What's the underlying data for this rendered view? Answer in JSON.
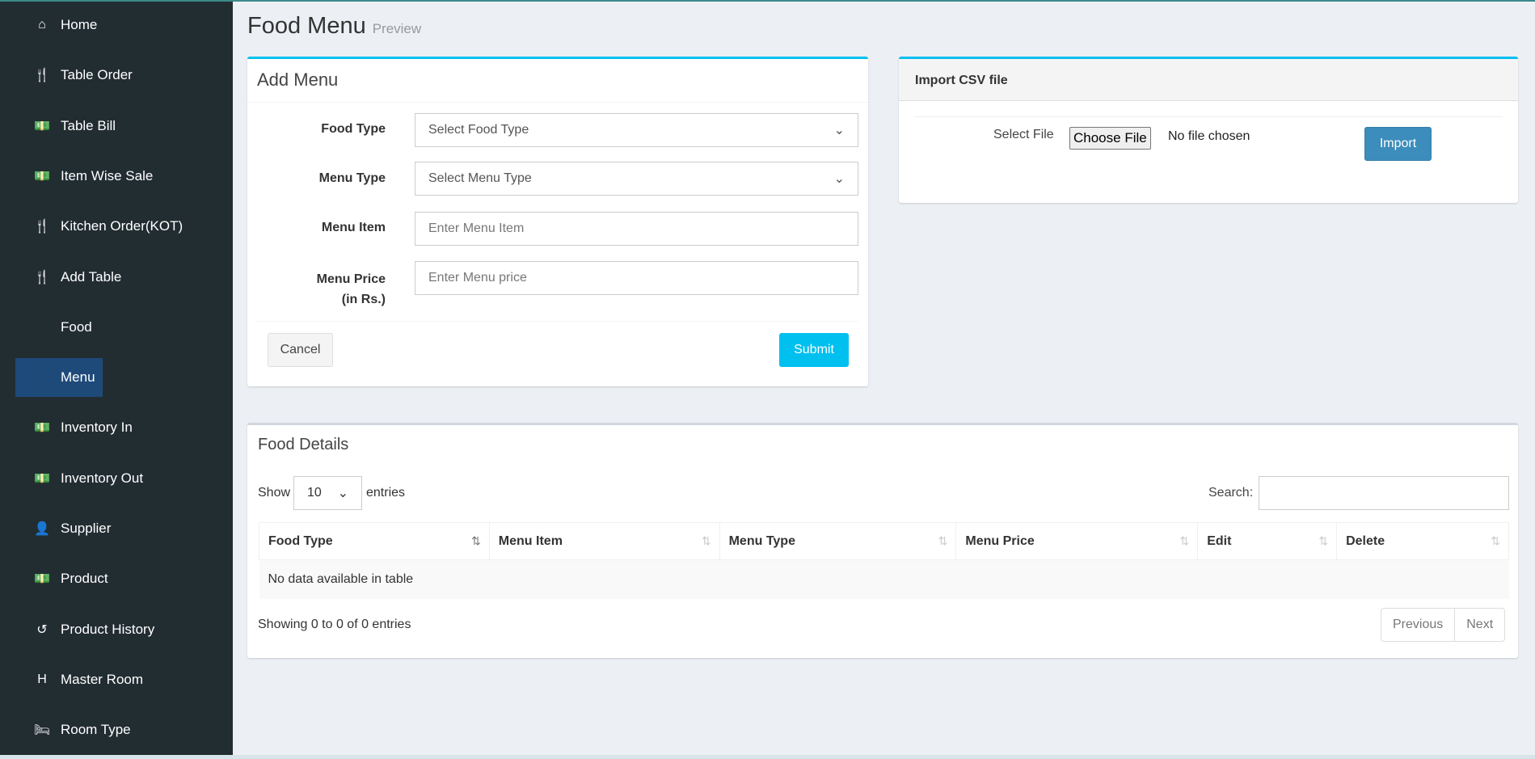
{
  "sidebar": {
    "items": [
      {
        "label": "Home",
        "icon": "home-icon",
        "glyph": "⌂"
      },
      {
        "label": "Table Order",
        "icon": "cutlery-icon",
        "glyph": "🍴"
      },
      {
        "label": "Table Bill",
        "icon": "money-icon",
        "glyph": "💵"
      },
      {
        "label": "Item Wise Sale",
        "icon": "money-icon",
        "glyph": "💵"
      },
      {
        "label": "Kitchen Order(KOT)",
        "icon": "cutlery-icon",
        "glyph": "🍴"
      },
      {
        "label": "Add Table",
        "icon": "cutlery-icon",
        "glyph": "🍴"
      },
      {
        "label": "Food",
        "icon": "apple-icon",
        "glyph": ""
      },
      {
        "label": "Menu",
        "icon": "apple-icon",
        "glyph": "",
        "active": true
      },
      {
        "label": "Inventory In",
        "icon": "money-icon",
        "glyph": "💵"
      },
      {
        "label": "Inventory Out",
        "icon": "money-icon",
        "glyph": "💵"
      },
      {
        "label": "Supplier",
        "icon": "user-icon",
        "glyph": "👤"
      },
      {
        "label": "Product",
        "icon": "money-icon",
        "glyph": "💵"
      },
      {
        "label": "Product History",
        "icon": "history-icon",
        "glyph": "↺"
      },
      {
        "label": "Master Room",
        "icon": "hospital-icon",
        "glyph": "H"
      },
      {
        "label": "Room Type",
        "icon": "bed-icon",
        "glyph": "🛏"
      }
    ]
  },
  "header": {
    "title": "Food Menu",
    "subtitle": "Preview"
  },
  "add_menu": {
    "title": "Add Menu",
    "food_type": {
      "label": "Food Type",
      "value": "Select Food Type"
    },
    "menu_type": {
      "label": "Menu Type",
      "value": "Select Menu Type"
    },
    "menu_item": {
      "label": "Menu Item",
      "placeholder": "Enter Menu Item"
    },
    "menu_price": {
      "label": "Menu Price",
      "label2": "(in Rs.)",
      "placeholder": "Enter Menu price"
    },
    "cancel": "Cancel",
    "submit": "Submit"
  },
  "import": {
    "title": "Import CSV file",
    "select_label": "Select File",
    "choose": "Choose File",
    "no_file": "No file chosen",
    "button": "Import"
  },
  "food_details": {
    "title": "Food Details",
    "show": "Show",
    "entries_value": "10",
    "entries": "entries",
    "search_label": "Search:",
    "columns": [
      "Food Type",
      "Menu Item",
      "Menu Type",
      "Menu Price",
      "Edit",
      "Delete"
    ],
    "empty": "No data available in table",
    "info": "Showing 0 to 0 of 0 entries",
    "previous": "Previous",
    "next": "Next"
  },
  "colors": {
    "sidebar": "#222d32",
    "active": "#1e4a7a",
    "primary": "#00c0ef",
    "import_btn": "#3c8dbc"
  }
}
